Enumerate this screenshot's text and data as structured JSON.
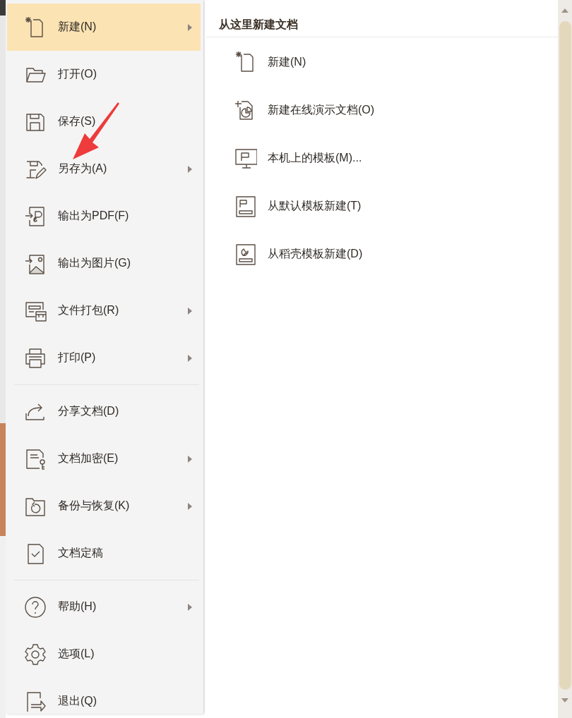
{
  "file_menu": {
    "sections": [
      {
        "items": [
          {
            "label": "新建(N)",
            "selected": true,
            "has_submenu": true
          },
          {
            "label": "打开(O)",
            "selected": false,
            "has_submenu": false
          },
          {
            "label": "保存(S)",
            "selected": false,
            "has_submenu": false
          },
          {
            "label": "另存为(A)",
            "selected": false,
            "has_submenu": true
          },
          {
            "label": "输出为PDF(F)",
            "selected": false,
            "has_submenu": false
          },
          {
            "label": "输出为图片(G)",
            "selected": false,
            "has_submenu": false
          },
          {
            "label": "文件打包(R)",
            "selected": false,
            "has_submenu": true
          },
          {
            "label": "打印(P)",
            "selected": false,
            "has_submenu": true
          }
        ]
      },
      {
        "items": [
          {
            "label": "分享文档(D)",
            "selected": false,
            "has_submenu": false
          },
          {
            "label": "文档加密(E)",
            "selected": false,
            "has_submenu": true
          },
          {
            "label": "备份与恢复(K)",
            "selected": false,
            "has_submenu": true
          },
          {
            "label": "文档定稿",
            "selected": false,
            "has_submenu": false
          }
        ]
      },
      {
        "items": [
          {
            "label": "帮助(H)",
            "selected": false,
            "has_submenu": true
          },
          {
            "label": "选项(L)",
            "selected": false,
            "has_submenu": false
          },
          {
            "label": "退出(Q)",
            "selected": false,
            "has_submenu": false
          }
        ]
      }
    ]
  },
  "submenu": {
    "title": "从这里新建文档",
    "items": [
      {
        "label": "新建(N)"
      },
      {
        "label": "新建在线演示文档(O)"
      },
      {
        "label": "本机上的模板(M)..."
      },
      {
        "label": "从默认模板新建(T)"
      },
      {
        "label": "从稻壳模板新建(D)"
      }
    ]
  }
}
